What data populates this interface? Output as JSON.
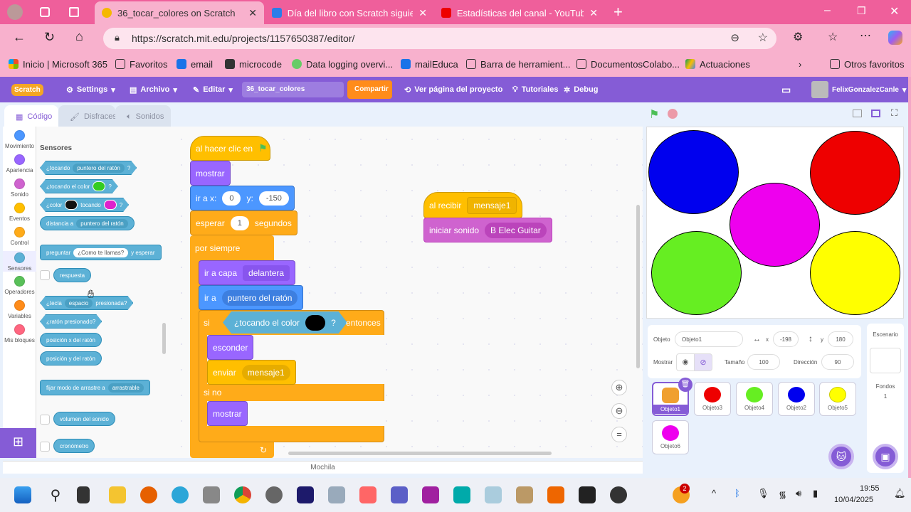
{
  "browser": {
    "tabs": [
      {
        "title": "36_tocar_colores on Scratch",
        "active": true
      },
      {
        "title": "Día del libro con Scratch siguiend",
        "active": false
      },
      {
        "title": "Estadísticas del canal - YouTube S",
        "active": false
      }
    ],
    "url": "https://scratch.mit.edu/projects/1157650387/editor/",
    "bookmarks": [
      "Inicio | Microsoft 365",
      "Favoritos",
      "email",
      "microcode",
      "Data logging overvi...",
      "mailEduca",
      "Barra de herramient...",
      "DocumentosColabo...",
      "Actuaciones"
    ],
    "other_bookmarks": "Otros favoritos",
    "theme_color": "#ef5f9b"
  },
  "scratch_menu": {
    "logo": "Scratch",
    "settings": "Settings",
    "file": "Archivo",
    "edit": "Editar",
    "project_title": "36_tocar_colores",
    "share": "Compartir",
    "project_page": "Ver página del proyecto",
    "tutorials": "Tutoriales",
    "debug": "Debug",
    "username": "FelixGonzalezCanle",
    "accent": "#855cd6"
  },
  "editor_tabs": [
    "Código",
    "Disfraces",
    "Sonidos"
  ],
  "categories": [
    {
      "label": "Movimiento",
      "color": "#4c97ff"
    },
    {
      "label": "Apariencia",
      "color": "#9966ff"
    },
    {
      "label": "Sonido",
      "color": "#cf63cf"
    },
    {
      "label": "Eventos",
      "color": "#ffbf00"
    },
    {
      "label": "Control",
      "color": "#ffab19"
    },
    {
      "label": "Sensores",
      "color": "#5cb1d6"
    },
    {
      "label": "Operadores",
      "color": "#59c059"
    },
    {
      "label": "Variables",
      "color": "#ff8c1a"
    },
    {
      "label": "Mis bloques",
      "color": "#ff6680"
    }
  ],
  "palette": {
    "heading": "Sensores",
    "touching": [
      "¿tocando",
      "puntero del ratón",
      "?"
    ],
    "touching_color": [
      "¿tocando el color",
      "?"
    ],
    "color_touching": [
      "¿color",
      "tocando",
      "?"
    ],
    "distance": [
      "distancia a",
      "puntero del ratón"
    ],
    "ask": [
      "preguntar",
      "¿Como te llamas?",
      "y esperar"
    ],
    "answer": "respuesta",
    "key_pressed": [
      "¿tecla",
      "espacio",
      "presionada?"
    ],
    "mouse_down": "¿ratón presionado?",
    "mouse_x": "posición x del ratón",
    "mouse_y": "posición y del ratón",
    "drag_mode": [
      "fijar modo de arrastre a",
      "arrastrable"
    ],
    "loudness": "volumen del sonido",
    "timer": "cronómetro"
  },
  "script1": {
    "when_flag": "al hacer clic en",
    "show": "mostrar",
    "goto_xy": [
      "ir a x:",
      "0",
      "y:",
      "-150"
    ],
    "wait": [
      "esperar",
      "1",
      "segundos"
    ],
    "forever": "por siempre",
    "front_layer": [
      "ir a capa",
      "delantera"
    ],
    "goto": [
      "ir a",
      "puntero del ratón"
    ],
    "if": [
      "si",
      "¿tocando el color",
      "?",
      "entonces"
    ],
    "hide": "esconder",
    "broadcast": [
      "enviar",
      "mensaje1"
    ],
    "else": "si no",
    "show2": "mostrar"
  },
  "script2": {
    "when_receive": [
      "al recibir",
      "mensaje1"
    ],
    "start_sound": [
      "iniciar sonido",
      "B Elec Guitar"
    ]
  },
  "backpack": "Mochila",
  "stage": {
    "circles": [
      {
        "color": "#0000ee"
      },
      {
        "color": "#ee0000"
      },
      {
        "color": "#ee00ee"
      },
      {
        "color": "#66ee22"
      },
      {
        "color": "#ffff00"
      }
    ]
  },
  "sprite_info": {
    "sprite_label": "Objeto",
    "sprite_name": "Objeto1",
    "x_label": "x",
    "x": "-198",
    "y_label": "y",
    "y": "180",
    "show_label": "Mostrar",
    "size_label": "Tamaño",
    "size": "100",
    "direction_label": "Dirección",
    "direction": "90"
  },
  "sprites": [
    {
      "name": "Objeto1",
      "color": "#f0a030",
      "selected": true
    },
    {
      "name": "Objeto3",
      "color": "#ee0000"
    },
    {
      "name": "Objeto4",
      "color": "#66ee22"
    },
    {
      "name": "Objeto2",
      "color": "#0000ee"
    },
    {
      "name": "Objeto5",
      "color": "#ffff00"
    },
    {
      "name": "Objeto6",
      "color": "#ee00ee"
    }
  ],
  "stage_panel": {
    "title": "Escenario",
    "backdrops_label": "Fondos",
    "backdrops": "1"
  },
  "taskbar": {
    "time": "19:55",
    "date": "10/04/2025",
    "badge": "2"
  }
}
